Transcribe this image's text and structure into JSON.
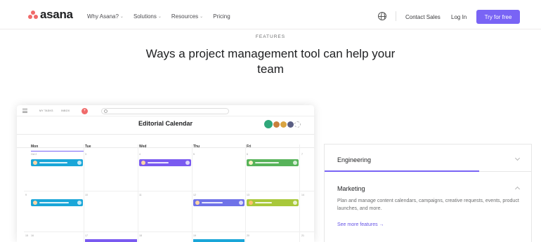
{
  "brand": {
    "name": "asana",
    "color": "#f06a6a"
  },
  "nav": {
    "menu": [
      {
        "label": "Why Asana?",
        "has_dropdown": true
      },
      {
        "label": "Solutions",
        "has_dropdown": true
      },
      {
        "label": "Resources",
        "has_dropdown": true
      },
      {
        "label": "Pricing",
        "has_dropdown": false
      }
    ],
    "globe_icon": "globe-icon",
    "contact_sales": "Contact Sales",
    "log_in": "Log In",
    "try_free": "Try for free",
    "accent_color": "#7964f5"
  },
  "hero": {
    "eyebrow": "FEATURES",
    "headline": "Ways a project management tool can help your team"
  },
  "mock": {
    "top_links": [
      "MY TASKS",
      "INBOX"
    ],
    "add_icon": "plus-icon",
    "title": "Editorial Calendar",
    "days": [
      "Mon",
      "Tue",
      "Wed",
      "Thu",
      "Fri"
    ],
    "week1_numbers": [
      "Oct 2",
      "3",
      "4",
      "5",
      "6",
      "7"
    ],
    "week2_numbers": [
      "9",
      "10",
      "11",
      "12",
      "13",
      "14"
    ],
    "week3_numbers": [
      "15",
      "16",
      "17",
      "18",
      "19",
      "20",
      "21"
    ],
    "task_colors": {
      "blue": "#1aa6d8",
      "purple": "#7a5af0",
      "green": "#57b35a",
      "lime": "#a8c83a"
    }
  },
  "features": {
    "engineering": "Engineering",
    "marketing": "Marketing",
    "marketing_desc": "Plan and manage content calendars, campaigns, creative requests, events, product launches, and more.",
    "see_more": "See more features →"
  }
}
